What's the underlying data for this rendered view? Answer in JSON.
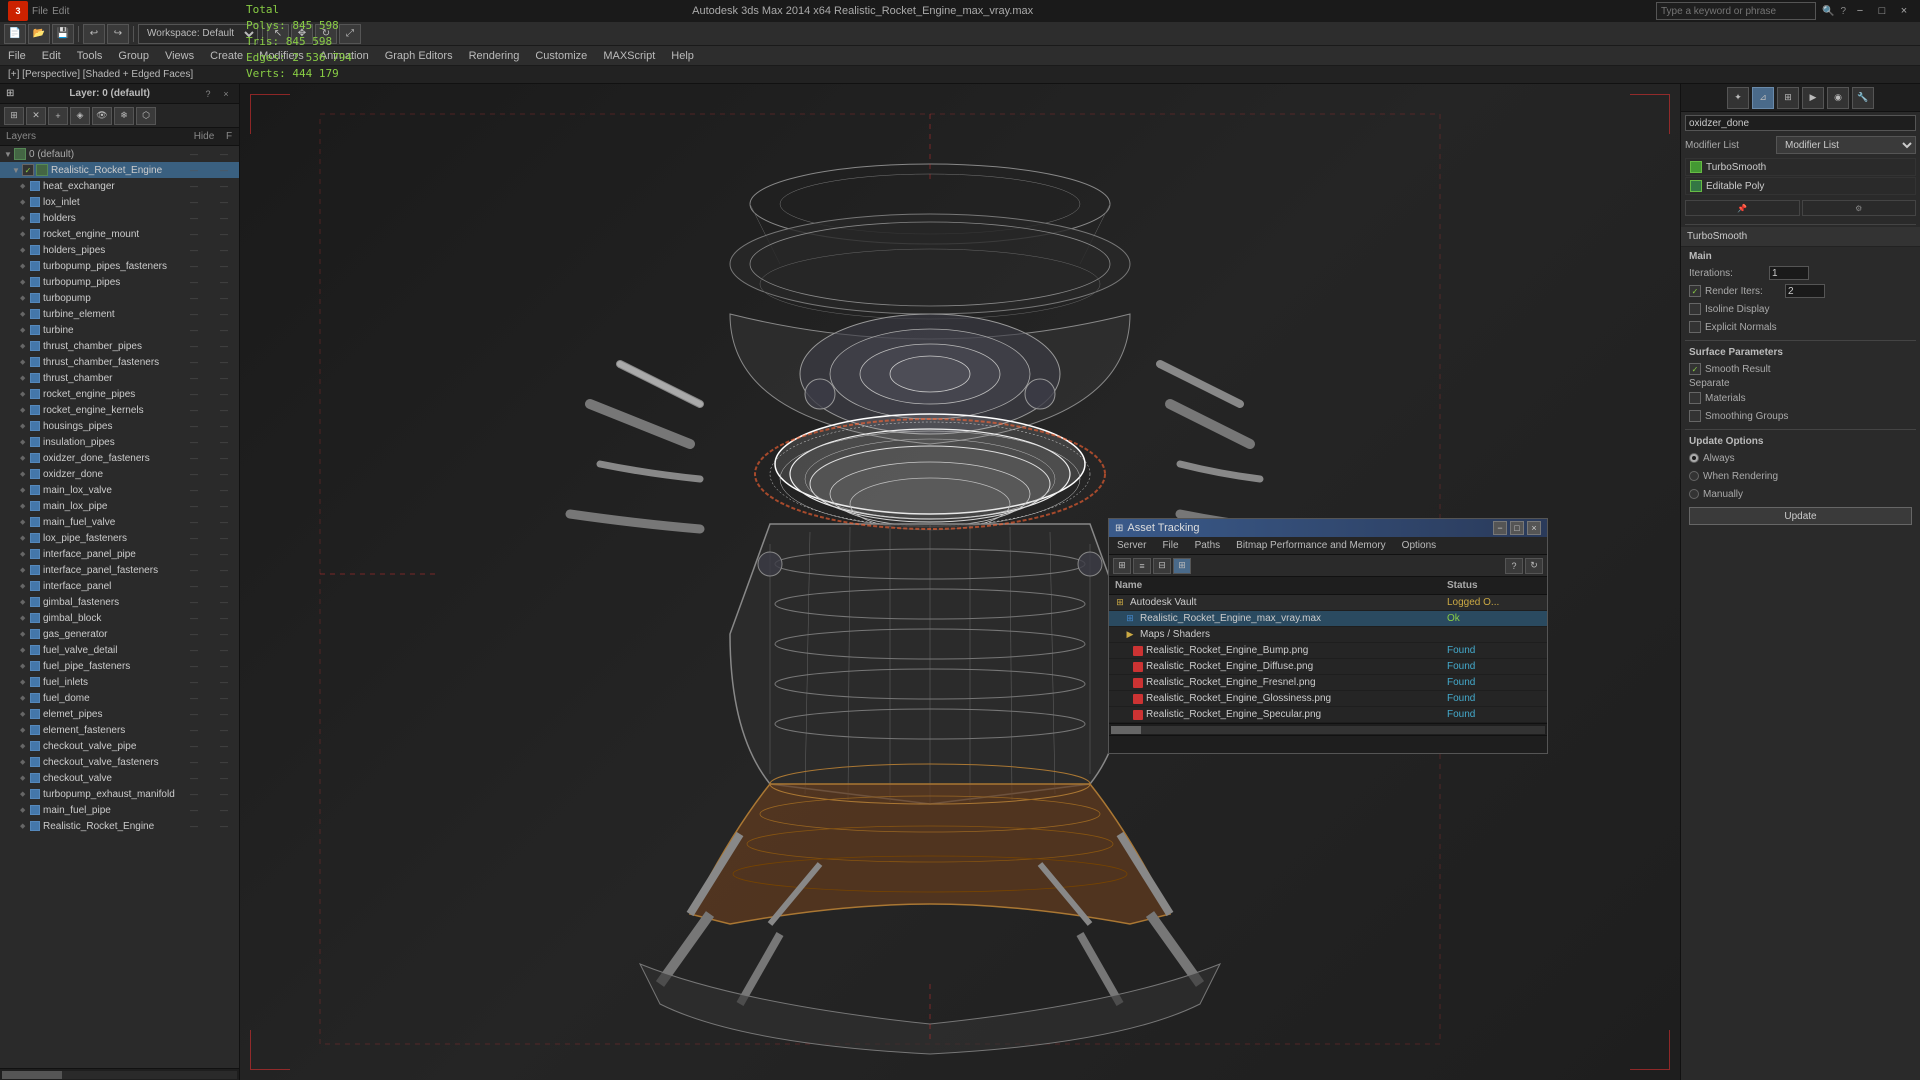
{
  "app": {
    "title": "Autodesk 3ds Max 2014 x64    Realistic_Rocket_Engine_max_vray.max",
    "workspace": "Workspace: Default"
  },
  "titlebar": {
    "minimize": "−",
    "maximize": "□",
    "close": "×"
  },
  "menubar": {
    "items": [
      "File",
      "Edit",
      "Tools",
      "Group",
      "Views",
      "Create",
      "Modifiers",
      "Animation",
      "Graph Editors",
      "Rendering",
      "Customize",
      "MAXScript",
      "Help"
    ]
  },
  "viewlabel": "[+] [Perspective] [Shaded + Edged Faces]",
  "stats": {
    "polys_label": "Polys:",
    "polys_value": "845 598",
    "tris_label": "Tris:",
    "tris_value": "845 598",
    "edges_label": "Edges:",
    "edges_value": "2 536 794",
    "verts_label": "Verts:",
    "verts_value": "444 179",
    "total_label": "Total"
  },
  "layers_panel": {
    "title": "Layer: 0 (default)",
    "col_layers": "Layers",
    "col_hide": "Hide",
    "col_f": "F",
    "items": [
      {
        "name": "0 (default)",
        "level": 0,
        "type": "layer",
        "is_default": true
      },
      {
        "name": "Realistic_Rocket_Engine",
        "level": 1,
        "type": "group",
        "selected": true
      },
      {
        "name": "heat_exchanger",
        "level": 2,
        "type": "obj"
      },
      {
        "name": "lox_inlet",
        "level": 2,
        "type": "obj"
      },
      {
        "name": "holders",
        "level": 2,
        "type": "obj"
      },
      {
        "name": "rocket_engine_mount",
        "level": 2,
        "type": "obj"
      },
      {
        "name": "holders_pipes",
        "level": 2,
        "type": "obj"
      },
      {
        "name": "turbopump_pipes_fasteners",
        "level": 2,
        "type": "obj"
      },
      {
        "name": "turbopump_pipes",
        "level": 2,
        "type": "obj"
      },
      {
        "name": "turbopump",
        "level": 2,
        "type": "obj"
      },
      {
        "name": "turbine_element",
        "level": 2,
        "type": "obj"
      },
      {
        "name": "turbine",
        "level": 2,
        "type": "obj"
      },
      {
        "name": "thrust_chamber_pipes",
        "level": 2,
        "type": "obj"
      },
      {
        "name": "thrust_chamber_fasteners",
        "level": 2,
        "type": "obj"
      },
      {
        "name": "thrust_chamber",
        "level": 2,
        "type": "obj"
      },
      {
        "name": "rocket_engine_pipes",
        "level": 2,
        "type": "obj"
      },
      {
        "name": "rocket_engine_kernels",
        "level": 2,
        "type": "obj"
      },
      {
        "name": "housings_pipes",
        "level": 2,
        "type": "obj"
      },
      {
        "name": "insulation_pipes",
        "level": 2,
        "type": "obj"
      },
      {
        "name": "oxidzer_done_fasteners",
        "level": 2,
        "type": "obj"
      },
      {
        "name": "oxidzer_done",
        "level": 2,
        "type": "obj"
      },
      {
        "name": "main_lox_valve",
        "level": 2,
        "type": "obj"
      },
      {
        "name": "main_lox_pipe",
        "level": 2,
        "type": "obj"
      },
      {
        "name": "main_fuel_valve",
        "level": 2,
        "type": "obj"
      },
      {
        "name": "lox_pipe_fasteners",
        "level": 2,
        "type": "obj"
      },
      {
        "name": "interface_panel_pipe",
        "level": 2,
        "type": "obj"
      },
      {
        "name": "interface_panel_fasteners",
        "level": 2,
        "type": "obj"
      },
      {
        "name": "interface_panel",
        "level": 2,
        "type": "obj"
      },
      {
        "name": "gimbal_fasteners",
        "level": 2,
        "type": "obj"
      },
      {
        "name": "gimbal_block",
        "level": 2,
        "type": "obj"
      },
      {
        "name": "gas_generator",
        "level": 2,
        "type": "obj"
      },
      {
        "name": "fuel_valve_detail",
        "level": 2,
        "type": "obj"
      },
      {
        "name": "fuel_pipe_fasteners",
        "level": 2,
        "type": "obj"
      },
      {
        "name": "fuel_inlets",
        "level": 2,
        "type": "obj"
      },
      {
        "name": "fuel_dome",
        "level": 2,
        "type": "obj"
      },
      {
        "name": "elemet_pipes",
        "level": 2,
        "type": "obj"
      },
      {
        "name": "element_fasteners",
        "level": 2,
        "type": "obj"
      },
      {
        "name": "checkout_valve_pipe",
        "level": 2,
        "type": "obj"
      },
      {
        "name": "checkout_valve_fasteners",
        "level": 2,
        "type": "obj"
      },
      {
        "name": "checkout_valve",
        "level": 2,
        "type": "obj"
      },
      {
        "name": "turbopump_exhaust_manifold",
        "level": 2,
        "type": "obj"
      },
      {
        "name": "main_fuel_pipe",
        "level": 2,
        "type": "obj"
      },
      {
        "name": "Realistic_Rocket_Engine",
        "level": 2,
        "type": "obj"
      }
    ]
  },
  "right_panel": {
    "name_field": "oxidzer_done",
    "modifier_list_label": "Modifier List",
    "modifiers": [
      {
        "name": "TurboSmooth",
        "type": "turbosmooth"
      },
      {
        "name": "Editable Poly",
        "type": "editable"
      }
    ],
    "turbosmooth": {
      "header": "TurboSmooth",
      "main_label": "Main",
      "iterations_label": "Iterations:",
      "iterations_value": "1",
      "render_iters_label": "Render Iters:",
      "render_iters_value": "2",
      "isoline_display_label": "Isoline Display",
      "explicit_normals_label": "Explicit Normals",
      "surface_params_label": "Surface Parameters",
      "smooth_result_label": "Smooth Result",
      "smooth_result_checked": true,
      "separate_label": "Separate",
      "materials_label": "Materials",
      "smoothing_groups_label": "Smoothing Groups",
      "update_options_label": "Update Options",
      "always_label": "Always",
      "when_rendering_label": "When Rendering",
      "manually_label": "Manually",
      "update_btn": "Update"
    }
  },
  "asset_tracking": {
    "title": "Asset Tracking",
    "menus": [
      "Server",
      "File",
      "Paths",
      "Bitmap Performance and Memory",
      "Options"
    ],
    "col_name": "Name",
    "col_status": "Status",
    "items": [
      {
        "name": "Autodesk Vault",
        "level": 0,
        "type": "vault",
        "status": "Logged O...",
        "status_type": "logged"
      },
      {
        "name": "Realistic_Rocket_Engine_max_vray.max",
        "level": 1,
        "type": "file",
        "status": "Ok",
        "status_type": "ok"
      },
      {
        "name": "Maps / Shaders",
        "level": 1,
        "type": "folder",
        "status": "",
        "status_type": ""
      },
      {
        "name": "Realistic_Rocket_Engine_Bump.png",
        "level": 2,
        "type": "texture",
        "status": "Found",
        "status_type": "found"
      },
      {
        "name": "Realistic_Rocket_Engine_Diffuse.png",
        "level": 2,
        "type": "texture",
        "status": "Found",
        "status_type": "found"
      },
      {
        "name": "Realistic_Rocket_Engine_Fresnel.png",
        "level": 2,
        "type": "texture",
        "status": "Found",
        "status_type": "found"
      },
      {
        "name": "Realistic_Rocket_Engine_Glossiness.png",
        "level": 2,
        "type": "texture",
        "status": "Found",
        "status_type": "found"
      },
      {
        "name": "Realistic_Rocket_Engine_Specular.png",
        "level": 2,
        "type": "texture",
        "status": "Found",
        "status_type": "found"
      }
    ]
  },
  "search": {
    "placeholder": "Type a keyword or phrase"
  }
}
